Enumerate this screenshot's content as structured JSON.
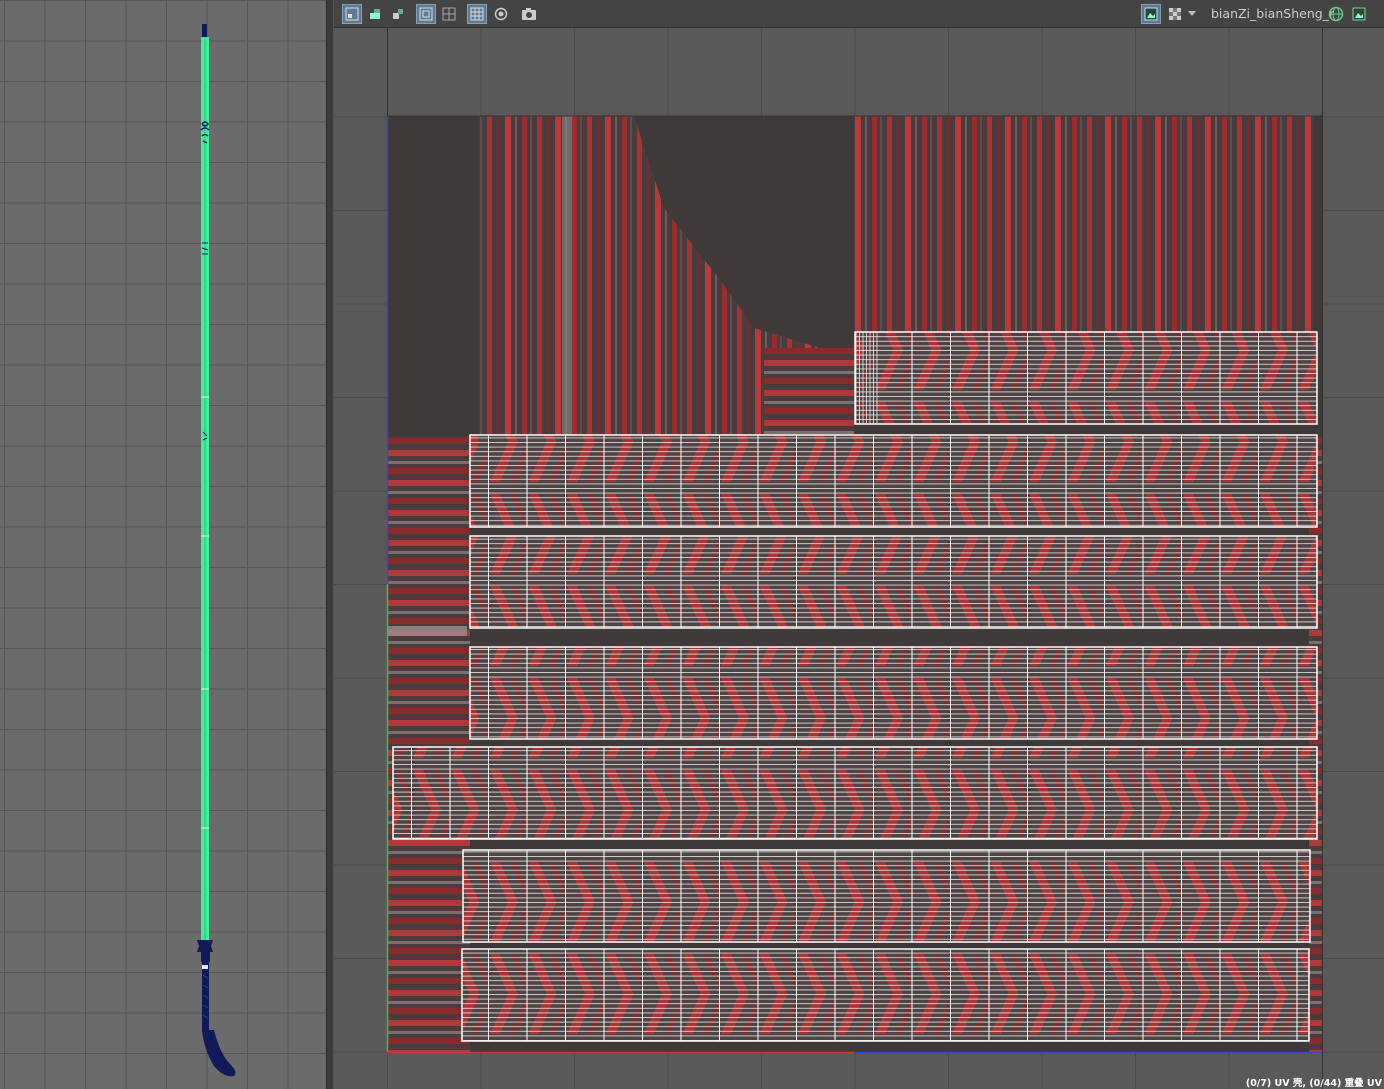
{
  "uv_editor": {
    "uv_set_name": "bianZi_bianSheng_r",
    "status": "(0/7) UV 壳, (0/44) 重叠 UV"
  },
  "toolbar": {
    "left_tools": [
      "uv-shell-icon",
      "move-tool-icon",
      "snap-icon",
      "isolate-select-icon",
      "grid-toggle-icon",
      "checker-icon",
      "pixel-snap-icon",
      "camera-snapshot-icon"
    ],
    "right_tools": [
      "image-display-icon",
      "checker-toggle-icon",
      "dropdown-arrow-icon",
      "uv-set-globe-icon",
      "image-icon"
    ]
  },
  "colors": {
    "accent_green": "#3cf09c",
    "uv_wire": "#ffffff",
    "texture_red": "#b03838",
    "selected_button": "#5d7a94"
  }
}
